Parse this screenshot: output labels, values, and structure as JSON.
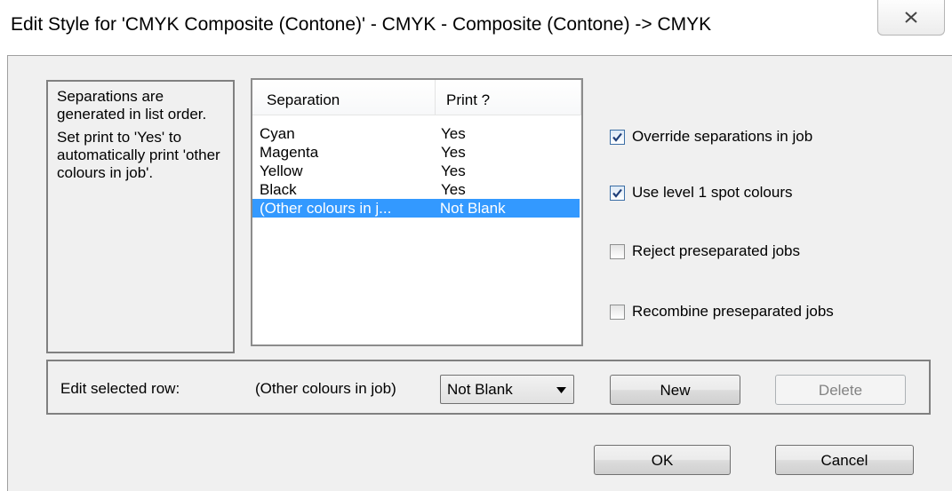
{
  "window": {
    "title": "Edit Style for 'CMYK Composite (Contone)' - CMYK - Composite (Contone) -> CMYK",
    "close_icon": "close-icon"
  },
  "help": {
    "paragraph1": "Separations are generated in list order.",
    "paragraph2": "Set print to 'Yes' to automatically print 'other colours in job'."
  },
  "separations": {
    "columns": [
      "Separation",
      "Print ?"
    ],
    "rows": [
      {
        "separation": "Cyan",
        "print": "Yes"
      },
      {
        "separation": "Magenta",
        "print": "Yes"
      },
      {
        "separation": "Yellow",
        "print": "Yes"
      },
      {
        "separation": "Black",
        "print": "Yes"
      },
      {
        "separation": "(Other colours in j...",
        "print": "Not Blank",
        "selected": true
      }
    ],
    "selection_color": "#3399ff"
  },
  "options": [
    {
      "label": "Override separations in job",
      "checked": true
    },
    {
      "label": "Use level 1 spot colours",
      "checked": true
    },
    {
      "label": "Reject preseparated jobs",
      "checked": false
    },
    {
      "label": "Recombine preseparated jobs",
      "checked": false
    }
  ],
  "edit_row": {
    "label": "Edit selected row:",
    "row_name": "(Other colours in job)",
    "print_value": "Not Blank",
    "new_label": "New",
    "delete_label": "Delete"
  },
  "footer": {
    "ok_label": "OK",
    "cancel_label": "Cancel"
  }
}
